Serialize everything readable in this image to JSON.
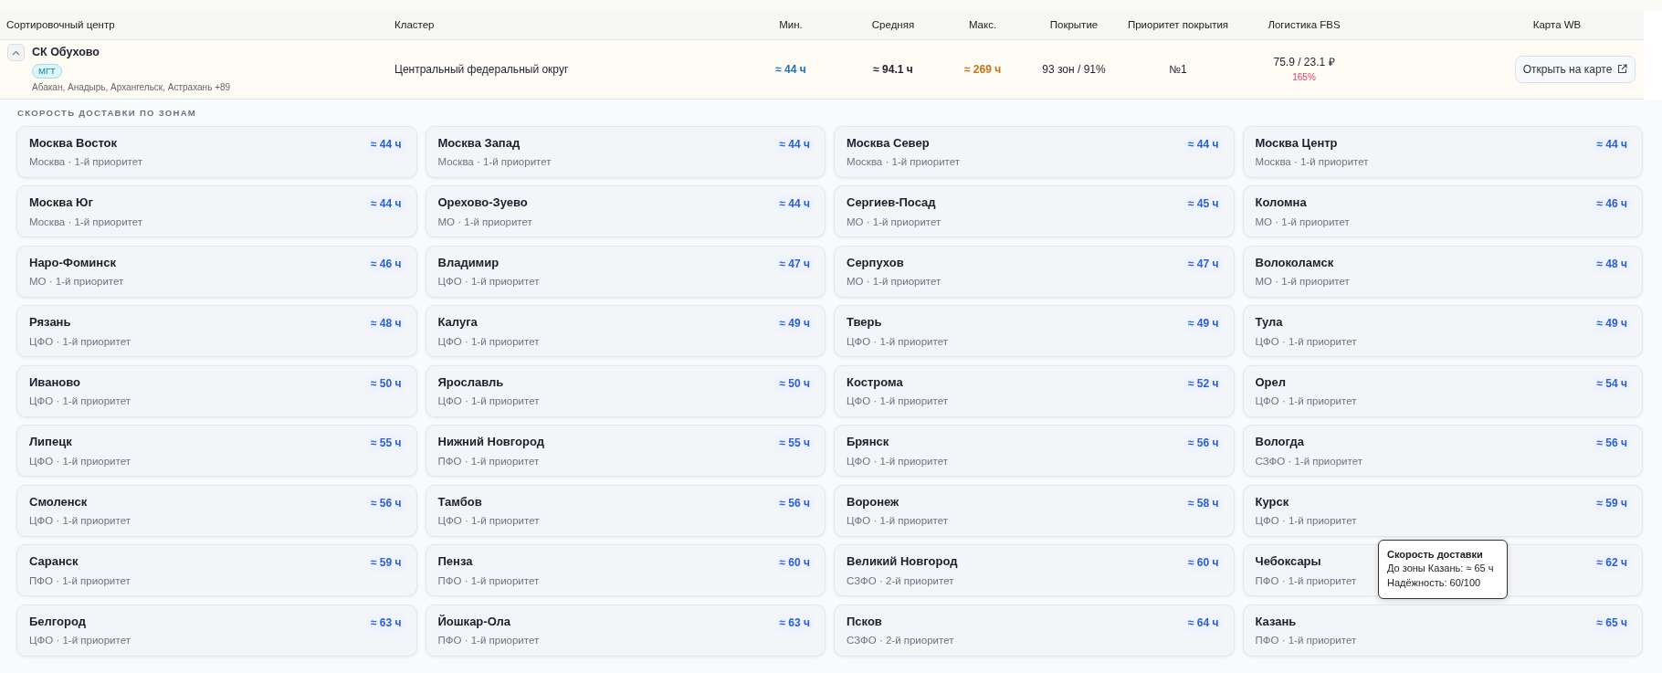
{
  "table": {
    "columns": [
      "Сортировочный центр",
      "Кластер",
      "Мин.",
      "Средняя",
      "Макс.",
      "Покрытие",
      "Приоритет покрытия",
      "Логистика FBS",
      "Карта WB"
    ],
    "rows": [
      {
        "expanded": true,
        "name": "СК Обухово",
        "badge": "МГТ",
        "cities": "Абакан, Анадырь, Архангельск, Астрахань +89",
        "cluster": "Центральный федеральный округ",
        "min": "≈ 44 ч",
        "avg": "≈ 94.1 ч",
        "max": "≈ 269 ч",
        "coverage": "93 зон / 91%",
        "coverage_priority": "№1",
        "logistics": "75.9 / 23.1 ₽",
        "logistics_percent": "165%",
        "map_button": "Открыть на карте"
      }
    ]
  },
  "zones_section": {
    "title": "СКОРОСТЬ ДОСТАВКИ ПО ЗОНАМ",
    "zones": [
      {
        "name": "Москва Восток",
        "subtitle": "Москва · 1-й приоритет",
        "value": "≈ 44 ч"
      },
      {
        "name": "Москва Запад",
        "subtitle": "Москва · 1-й приоритет",
        "value": "≈ 44 ч"
      },
      {
        "name": "Москва Север",
        "subtitle": "Москва · 1-й приоритет",
        "value": "≈ 44 ч"
      },
      {
        "name": "Москва Центр",
        "subtitle": "Москва · 1-й приоритет",
        "value": "≈ 44 ч"
      },
      {
        "name": "Москва Юг",
        "subtitle": "Москва · 1-й приоритет",
        "value": "≈ 44 ч"
      },
      {
        "name": "Орехово-Зуево",
        "subtitle": "МО · 1-й приоритет",
        "value": "≈ 44 ч"
      },
      {
        "name": "Сергиев-Посад",
        "subtitle": "МО · 1-й приоритет",
        "value": "≈ 45 ч"
      },
      {
        "name": "Коломна",
        "subtitle": "МО · 1-й приоритет",
        "value": "≈ 46 ч"
      },
      {
        "name": "Наро-Фоминск",
        "subtitle": "МО · 1-й приоритет",
        "value": "≈ 46 ч"
      },
      {
        "name": "Владимир",
        "subtitle": "ЦФО · 1-й приоритет",
        "value": "≈ 47 ч"
      },
      {
        "name": "Серпухов",
        "subtitle": "МО · 1-й приоритет",
        "value": "≈ 47 ч"
      },
      {
        "name": "Волоколамск",
        "subtitle": "МО · 1-й приоритет",
        "value": "≈ 48 ч"
      },
      {
        "name": "Рязань",
        "subtitle": "ЦФО · 1-й приоритет",
        "value": "≈ 48 ч"
      },
      {
        "name": "Калуга",
        "subtitle": "ЦФО · 1-й приоритет",
        "value": "≈ 49 ч"
      },
      {
        "name": "Тверь",
        "subtitle": "ЦФО · 1-й приоритет",
        "value": "≈ 49 ч"
      },
      {
        "name": "Тула",
        "subtitle": "ЦФО · 1-й приоритет",
        "value": "≈ 49 ч"
      },
      {
        "name": "Иваново",
        "subtitle": "ЦФО · 1-й приоритет",
        "value": "≈ 50 ч"
      },
      {
        "name": "Ярославль",
        "subtitle": "ЦФО · 1-й приоритет",
        "value": "≈ 50 ч"
      },
      {
        "name": "Кострома",
        "subtitle": "ЦФО · 1-й приоритет",
        "value": "≈ 52 ч"
      },
      {
        "name": "Орел",
        "subtitle": "ЦФО · 1-й приоритет",
        "value": "≈ 54 ч"
      },
      {
        "name": "Липецк",
        "subtitle": "ЦФО · 1-й приоритет",
        "value": "≈ 55 ч"
      },
      {
        "name": "Нижний Новгород",
        "subtitle": "ПФО · 1-й приоритет",
        "value": "≈ 55 ч"
      },
      {
        "name": "Брянск",
        "subtitle": "ЦФО · 1-й приоритет",
        "value": "≈ 56 ч"
      },
      {
        "name": "Вологда",
        "subtitle": "СЗФО · 1-й приоритет",
        "value": "≈ 56 ч"
      },
      {
        "name": "Смоленск",
        "subtitle": "ЦФО · 1-й приоритет",
        "value": "≈ 56 ч"
      },
      {
        "name": "Тамбов",
        "subtitle": "ЦФО · 1-й приоритет",
        "value": "≈ 56 ч"
      },
      {
        "name": "Воронеж",
        "subtitle": "ЦФО · 1-й приоритет",
        "value": "≈ 58 ч"
      },
      {
        "name": "Курск",
        "subtitle": "ЦФО · 1-й приоритет",
        "value": "≈ 59 ч"
      },
      {
        "name": "Саранск",
        "subtitle": "ПФО · 1-й приоритет",
        "value": "≈ 59 ч"
      },
      {
        "name": "Пенза",
        "subtitle": "ПФО · 1-й приоритет",
        "value": "≈ 60 ч"
      },
      {
        "name": "Великий Новгород",
        "subtitle": "СЗФО · 2-й приоритет",
        "value": "≈ 60 ч"
      },
      {
        "name": "Чебоксары",
        "subtitle": "ПФО · 1-й приоритет",
        "value": "≈ 62 ч"
      },
      {
        "name": "Белгород",
        "subtitle": "ЦФО · 1-й приоритет",
        "value": "≈ 63 ч"
      },
      {
        "name": "Йошкар-Ола",
        "subtitle": "ПФО · 1-й приоритет",
        "value": "≈ 63 ч"
      },
      {
        "name": "Псков",
        "subtitle": "СЗФО · 2-й приоритет",
        "value": "≈ 64 ч"
      },
      {
        "name": "Казань",
        "subtitle": "ПФО · 1-й приоритет",
        "value": "≈ 65 ч"
      }
    ]
  },
  "tooltip": {
    "title": "Скорость доставки",
    "lines": [
      "До зоны Казань: ≈ 65 ч",
      "Надёжность: 60/100"
    ]
  }
}
